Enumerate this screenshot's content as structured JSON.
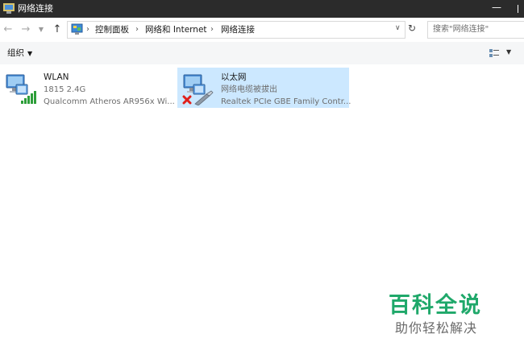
{
  "window": {
    "title": "网络连接"
  },
  "address": {
    "breadcrumbs": [
      "控制面板",
      "网络和 Internet",
      "网络连接"
    ],
    "search_placeholder": "搜索\"网络连接\""
  },
  "command_bar": {
    "organize_label": "组织"
  },
  "connections": [
    {
      "name": "WLAN",
      "status": "1815 2.4G",
      "adapter": "Qualcomm Atheros AR956x Wi...",
      "icon": "wifi-adapter-icon",
      "selected": false
    },
    {
      "name": "以太网",
      "status": "网络电缆被拔出",
      "adapter": "Realtek PCIe GBE Family Contr...",
      "icon": "ethernet-adapter-icon",
      "selected": true
    }
  ],
  "watermark": {
    "title": "百科全说",
    "subtitle": "助你轻松解决"
  },
  "colors": {
    "titlebar": "#2b2b2b",
    "selection": "#cce8ff",
    "watermark": "#1fa86a",
    "signal": "#2e9e3a",
    "error_x": "#e0201b"
  }
}
